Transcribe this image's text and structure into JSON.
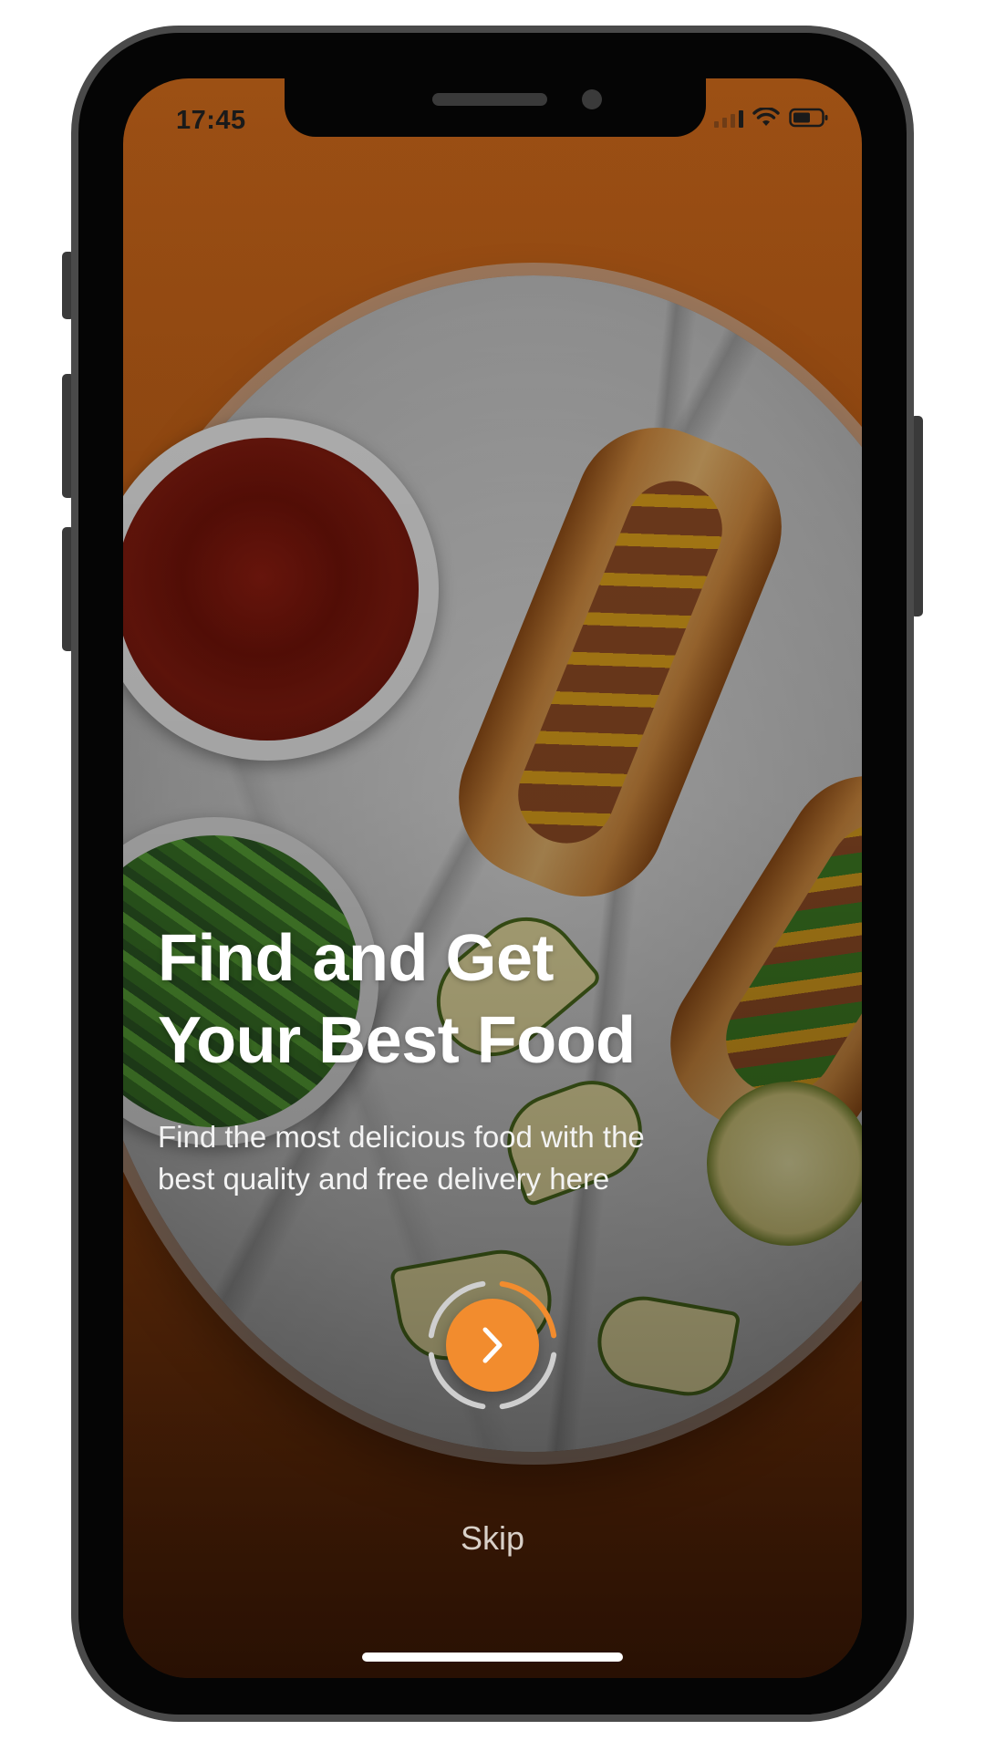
{
  "status_bar": {
    "time": "17:45",
    "icons": [
      "signal-icon",
      "wifi-icon",
      "battery-icon"
    ]
  },
  "onboarding": {
    "headline_line1": "Find and Get",
    "headline_line2": "Your Best Food",
    "subtitle_line1": "Find the most delicious food with the",
    "subtitle_line2": "best quality and free delivery here",
    "next_icon": "chevron-right-icon",
    "skip_label": "Skip",
    "progress_fraction": 0.25
  },
  "colors": {
    "accent": "#f28c2e",
    "background_orange": "#c8661a",
    "text_primary": "#ffffff"
  }
}
